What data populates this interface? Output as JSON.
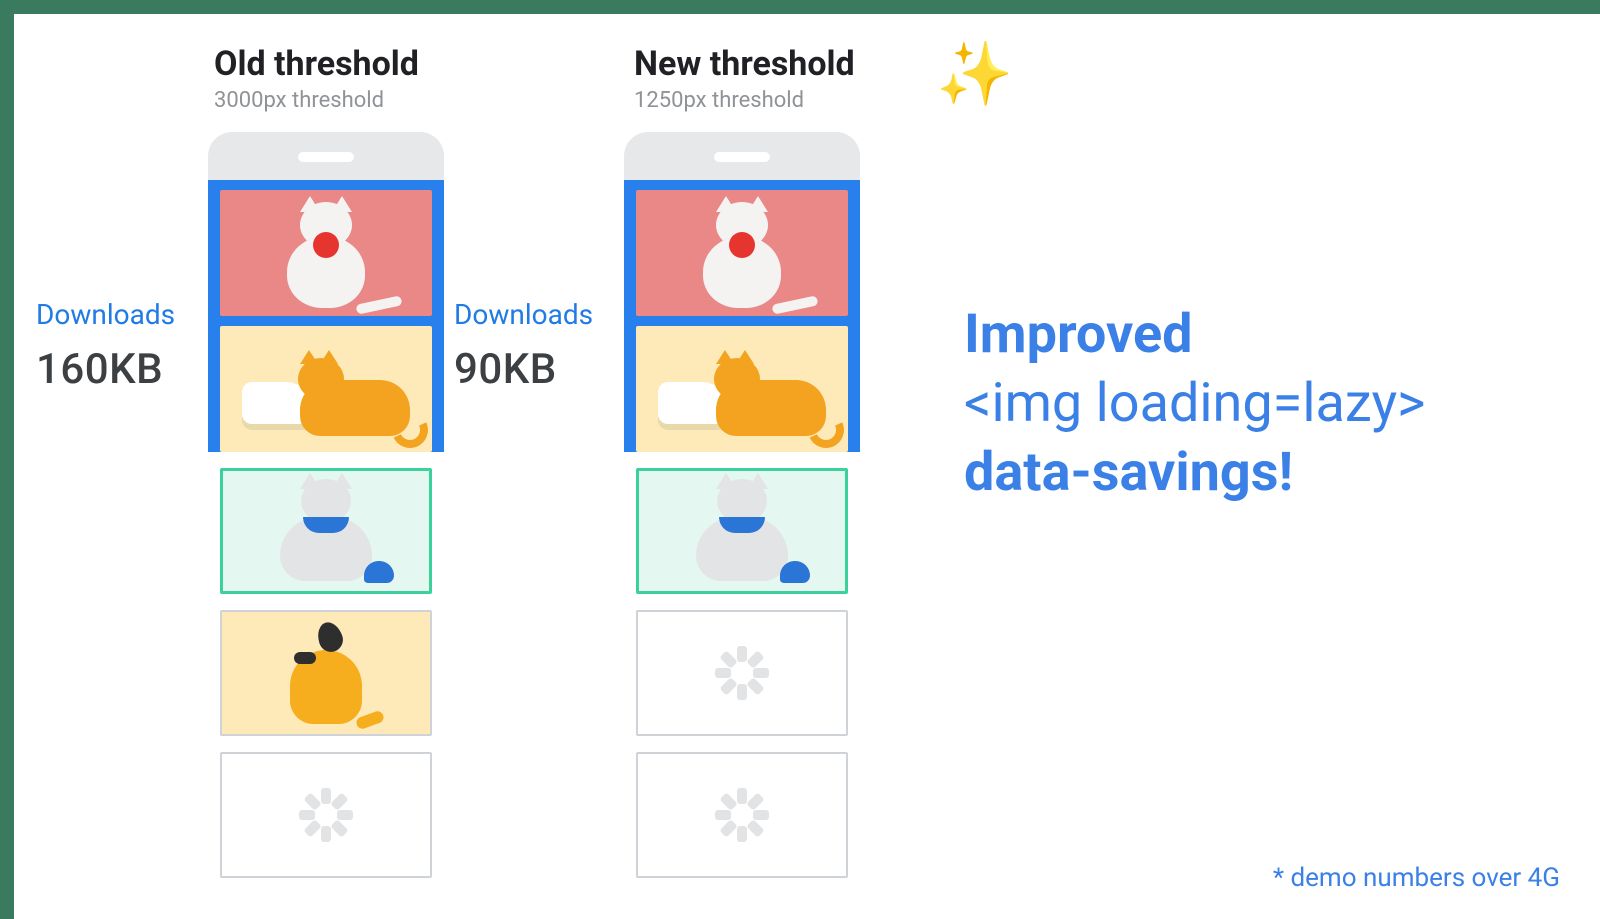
{
  "columns": {
    "old": {
      "title": "Old threshold",
      "subtitle": "3000px threshold"
    },
    "new": {
      "title": "New threshold",
      "subtitle": "1250px threshold"
    }
  },
  "sparkle_icon": "✨",
  "downloads": {
    "label": "Downloads",
    "old_value": "160KB",
    "new_value": "90KB"
  },
  "headline": {
    "line1": "Improved",
    "line2": "<img loading=lazy>",
    "line3": "data-savings!"
  },
  "footnote": "* demo numbers over 4G",
  "images": {
    "cat_red_yarn": "white-cat-with-red-yarn",
    "orange_cat_sneaker": "orange-cat-with-sneaker",
    "grey_cat_blue": "grey-cat-blue-collar",
    "orange_dog": "orange-dog",
    "placeholder": "loading-placeholder"
  }
}
